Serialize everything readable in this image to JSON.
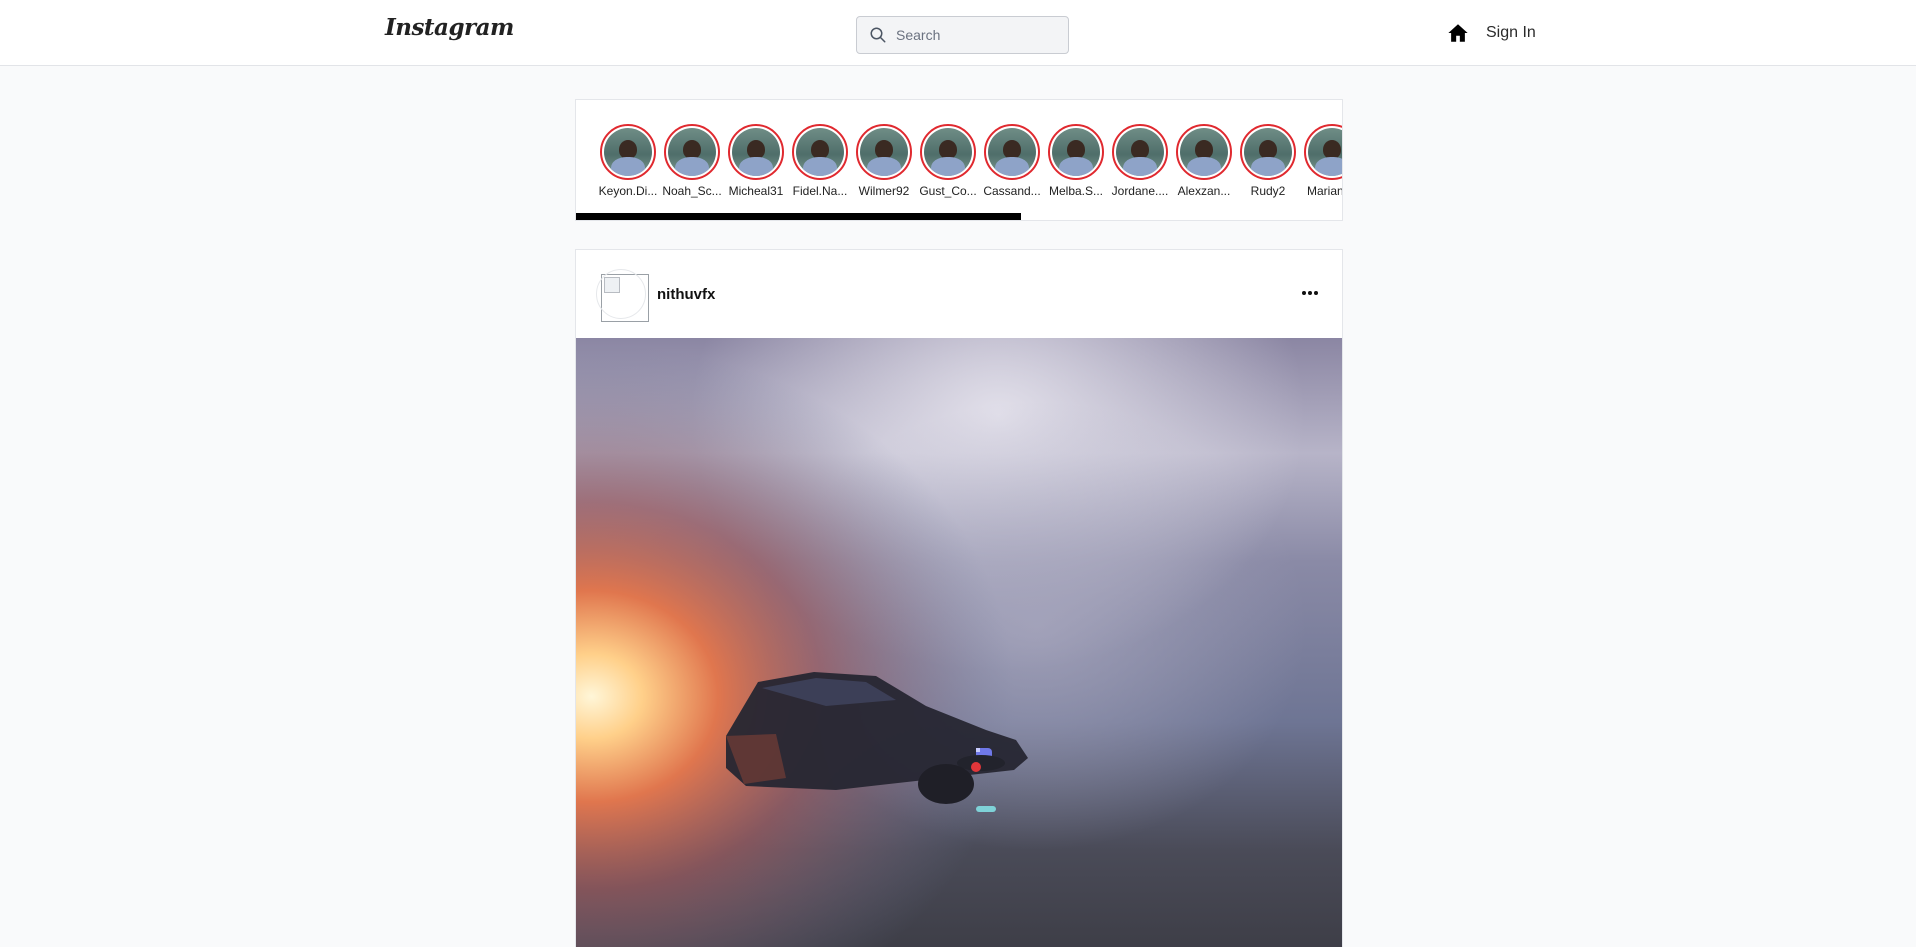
{
  "header": {
    "logo": "Instagram",
    "search_placeholder": "Search",
    "icons": {
      "search": "search-icon",
      "home": "home-icon"
    },
    "signin_label": "Sign In"
  },
  "stories": [
    {
      "name": "Keyon.Di..."
    },
    {
      "name": "Noah_Sc..."
    },
    {
      "name": "Micheal31"
    },
    {
      "name": "Fidel.Na..."
    },
    {
      "name": "Wilmer92"
    },
    {
      "name": "Gust_Co..."
    },
    {
      "name": "Cassand..."
    },
    {
      "name": "Melba.S..."
    },
    {
      "name": "Jordane...."
    },
    {
      "name": "Alexzan..."
    },
    {
      "name": "Rudy2"
    },
    {
      "name": "Marianne"
    }
  ],
  "stories_scroll_fraction": 0.58,
  "post": {
    "username": "nithuvfx",
    "more_icon": "more-horizontal-icon"
  },
  "colors": {
    "story_ring": "#e0292f",
    "background": "#f9fafb"
  }
}
